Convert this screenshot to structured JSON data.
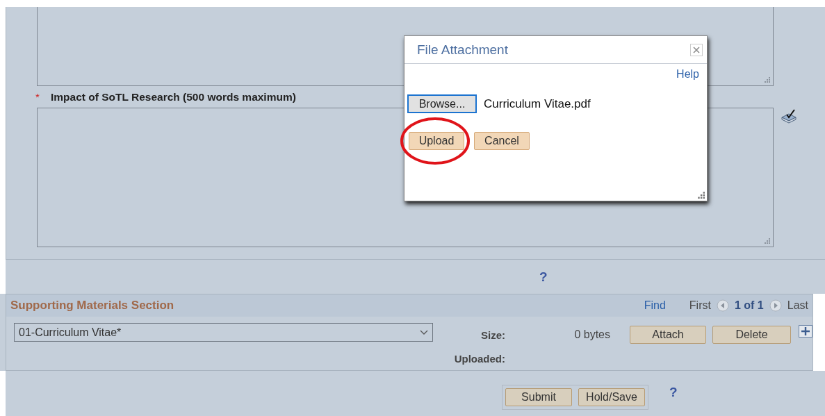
{
  "essay": {
    "required_mark": "*",
    "label": "Impact of SoTL Research (500 words maximum)"
  },
  "section_help": "?",
  "supporting_materials": {
    "title": "Supporting Materials Section",
    "nav": {
      "find": "Find",
      "first": "First",
      "position": "1 of 1",
      "last": "Last"
    },
    "document_select": {
      "value": "01-Curriculum Vitae*"
    },
    "size_label": "Size:",
    "size_value": "0 bytes",
    "uploaded_label": "Uploaded:",
    "buttons": [
      "Attach",
      "Delete"
    ]
  },
  "footer_buttons": [
    "Submit",
    "Hold/Save"
  ],
  "footer_help": "?",
  "dialog": {
    "title": "File Attachment",
    "help": "Help",
    "browse": "Browse...",
    "file_name": "Curriculum Vitae.pdf",
    "buttons": [
      {
        "label": "Upload",
        "highlighted": true
      },
      {
        "label": "Cancel",
        "highlighted": false
      }
    ]
  }
}
